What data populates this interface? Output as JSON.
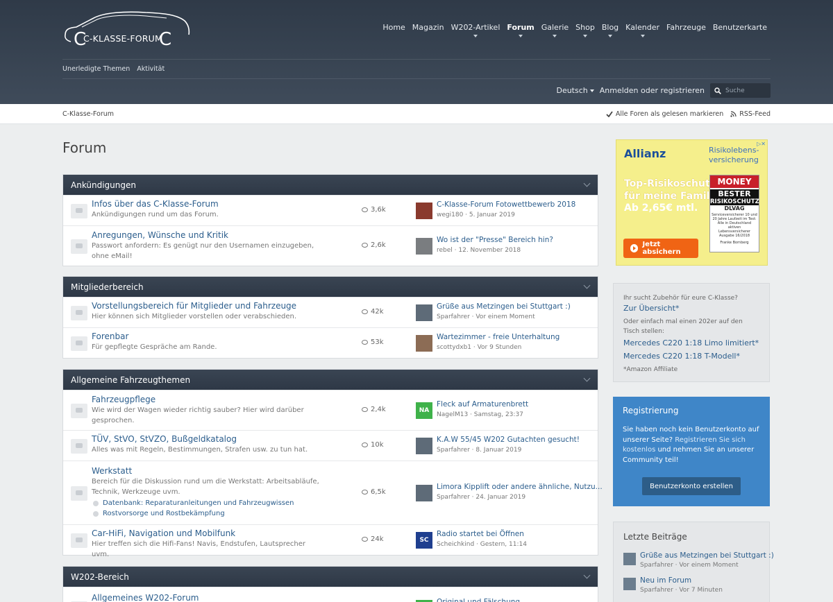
{
  "site": {
    "logo_text": "C-KLASSE-FORUM",
    "nav": [
      {
        "label": "Home",
        "caret": false,
        "active": false
      },
      {
        "label": "Magazin",
        "caret": false,
        "active": false
      },
      {
        "label": "W202-Artikel",
        "caret": true,
        "active": false
      },
      {
        "label": "Forum",
        "caret": true,
        "active": true
      },
      {
        "label": "Galerie",
        "caret": true,
        "active": false
      },
      {
        "label": "Shop",
        "caret": true,
        "active": false
      },
      {
        "label": "Blog",
        "caret": true,
        "active": false
      },
      {
        "label": "Kalender",
        "caret": true,
        "active": false
      },
      {
        "label": "Fahrzeuge",
        "caret": false,
        "active": false
      },
      {
        "label": "Benutzerkarte",
        "caret": false,
        "active": false
      }
    ],
    "subnav": [
      "Unerledigte Themen",
      "Aktivität"
    ],
    "language": "Deutsch",
    "login": "Anmelden oder registrieren",
    "search_placeholder": "Suche"
  },
  "breadcrumb": {
    "home": "C-Klasse-Forum",
    "mark_read": "Alle Foren als gelesen markieren",
    "rss": "RSS-Feed"
  },
  "page": {
    "title": "Forum"
  },
  "categories": [
    {
      "title": "Ankündigungen",
      "nodes": [
        {
          "title": "Infos über das C-Klasse-Forum",
          "desc": "Ankündigungen rund um das Forum.",
          "count": "3,6k",
          "last_title": "C-Klasse-Forum Fotowettbewerb 2018",
          "last_meta": "wegi180 · 5. Januar 2019",
          "avatar_text": "",
          "avatar_color": "#8a3a2e"
        },
        {
          "title": "Anregungen, Wünsche und Kritik",
          "desc": "Passwort anfordern: Es genügt nur den Usernamen einzugeben, ohne eMail!",
          "count": "2,6k",
          "last_title": "Wo ist der \"Presse\" Bereich hin?",
          "last_meta": "rebel · 12. November 2018",
          "avatar_text": "",
          "avatar_color": "#7a7d80"
        }
      ]
    },
    {
      "title": "Mitgliederbereich",
      "nodes": [
        {
          "title": "Vorstellungsbereich für Mitglieder und Fahrzeuge",
          "desc": "Hier können sich Mitglieder vorstellen oder verabschieden.",
          "count": "42k",
          "last_title": "Grüße aus Metzingen bei Stuttgart :)",
          "last_meta": "Sparfahrer · Vor einem Moment",
          "avatar_text": "",
          "avatar_color": "#5e6b78"
        },
        {
          "title": "Forenbar",
          "desc": "Für gepflegte Gespräche am Rande.",
          "count": "53k",
          "last_title": "Wartezimmer - freie Unterhaltung",
          "last_meta": "scottydxb1 · Vor 9 Stunden",
          "avatar_text": "",
          "avatar_color": "#8c6c55"
        }
      ]
    },
    {
      "title": "Allgemeine Fahrzeugthemen",
      "nodes": [
        {
          "title": "Fahrzeugpflege",
          "desc": "Wie wird der Wagen wieder richtig sauber? Hier wird darüber gesprochen.",
          "count": "2,4k",
          "last_title": "Fleck auf Armaturenbrett",
          "last_meta": "NagelM13 · Samstag, 23:37",
          "avatar_text": "NA",
          "avatar_color": "#3fb24a"
        },
        {
          "title": "TÜV, StVO, StVZO, Bußgeldkatalog",
          "desc": "Alles was mit Regeln, Bestimmungen, Strafen usw. zu tun hat.",
          "count": "10k",
          "last_title": "K.A.W 55/45 W202 Gutachten gesucht!",
          "last_meta": "Sparfahrer · 8. Januar 2019",
          "avatar_text": "",
          "avatar_color": "#5e6b78"
        },
        {
          "title": "Werkstatt",
          "desc": "Bereich für die Diskussion rund um die Werkstatt: Arbeitsabläufe, Technik, Werkzeuge uvm.",
          "count": "6,5k",
          "last_title": "Limora Kipplift oder andere ähnliche, Nutzu...",
          "last_meta": "Sparfahrer · 24. Januar 2019",
          "avatar_text": "",
          "avatar_color": "#5e6b78",
          "subforums": [
            "Datenbank: Reparaturanleitungen und Fahrzeugwissen",
            "Rostvorsorge und Rostbekämpfung"
          ]
        },
        {
          "title": "Car-HiFi, Navigation und Mobilfunk",
          "desc": "Hier treffen sich die Hifi-Fans! Navis, Endstufen, Lautsprecher uvm.",
          "count": "24k",
          "last_title": "Radio startet bei Öffnen",
          "last_meta": "Scheichkind · Gestern, 11:14",
          "avatar_text": "SC",
          "avatar_color": "#1f3f8f"
        }
      ]
    },
    {
      "title": "W202-Bereich",
      "nodes": [
        {
          "title": "Allgemeines W202-Forum",
          "desc": "",
          "count": "",
          "last_title": "Original und Fälschung",
          "last_meta": "",
          "avatar_text": "",
          "avatar_color": "#3fb24a"
        }
      ]
    }
  ],
  "sidebar": {
    "ad": {
      "brand": "Allianz",
      "tagline_1": "Risikolebens-",
      "tagline_2": "versicherung",
      "headline_1": "Top-Risikoschutz",
      "headline_2": "für meine Familie.",
      "price": "Ab 2,65€ mtl.",
      "seal_money": "MONEY",
      "seal_best": "BESTER",
      "seal_risk": "RISIKOSCHUTZ",
      "seal_name": "DLVAG",
      "seal_fine": "Serviceversicherer 10 und 20 Jahre Laufzeit im Test: Alle in Deutschland aktiven Lebensversicherer Ausgabe 16/2018",
      "seal_footer": "Franke Bornberg",
      "cta": "Jetzt absichern"
    },
    "amazon": {
      "intro": "Ihr sucht Zubehör für eure C-Klasse?",
      "link1": "Zur Übersicht*",
      "text2": "Oder einfach mal einen 202er auf den Tisch stellen:",
      "link2": "Mercedes C220 1:18 Limo limitiert*",
      "link3": "Mercedes C220 1:18 T-Modell*",
      "note": "*Amazon Affiliate"
    },
    "register": {
      "title": "Registrierung",
      "text_a": "Sie haben noch kein Benutzerkonto auf unserer Seite? ",
      "text_link": "Registrieren Sie sich kostenlos",
      "text_b": " und nehmen Sie an unserer Community teil!",
      "button": "Benutzerkonto erstellen"
    },
    "latest": {
      "title": "Letzte Beiträge",
      "posts": [
        {
          "title": "Grüße aus Metzingen bei Stuttgart :)",
          "meta": "Sparfahrer · Vor einem Moment"
        },
        {
          "title": "Neu im Forum",
          "meta": "Sparfahrer · Vor 7 Minuten"
        }
      ]
    }
  }
}
